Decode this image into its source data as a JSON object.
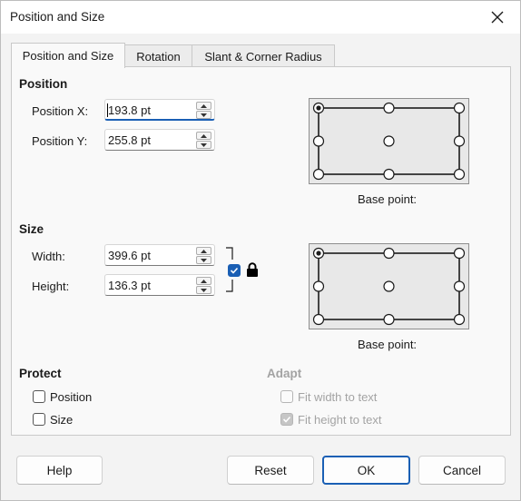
{
  "window": {
    "title": "Position and Size",
    "close_icon": "close-icon"
  },
  "tabs": [
    {
      "label": "Position and Size",
      "active": true
    },
    {
      "label": "Rotation",
      "active": false
    },
    {
      "label": "Slant & Corner Radius",
      "active": false
    }
  ],
  "position": {
    "section_title": "Position",
    "x_label": "Position X:",
    "x_value": "193.8 pt",
    "y_label": "Position Y:",
    "y_value": "255.8 pt",
    "base_point_label": "Base point:",
    "base_point_selected": "top-left"
  },
  "size": {
    "section_title": "Size",
    "width_label": "Width:",
    "width_value": "399.6 pt",
    "height_label": "Height:",
    "height_value": "136.3 pt",
    "keep_ratio_checked": true,
    "lock_icon": "lock-icon",
    "base_point_label": "Base point:",
    "base_point_selected": "top-left"
  },
  "protect": {
    "section_title": "Protect",
    "position_label": "Position",
    "position_checked": false,
    "size_label": "Size",
    "size_checked": false
  },
  "adapt": {
    "section_title": "Adapt",
    "fit_width_label": "Fit width to text",
    "fit_width_checked": false,
    "fit_height_label": "Fit height to text",
    "fit_height_checked": true,
    "enabled": false
  },
  "buttons": {
    "help": "Help",
    "reset": "Reset",
    "ok": "OK",
    "cancel": "Cancel"
  },
  "colors": {
    "accent": "#1a5fb4",
    "disabled_text": "#a3a3a3"
  }
}
